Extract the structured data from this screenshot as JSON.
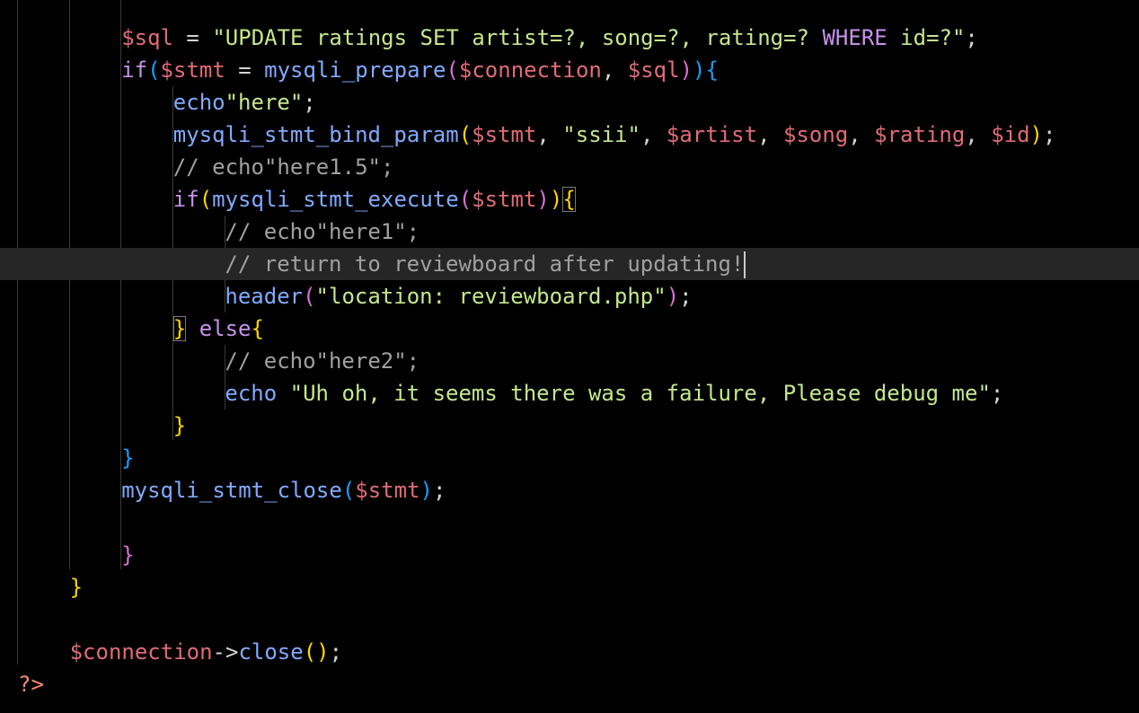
{
  "editor": {
    "language": "php",
    "theme_background": "#000000",
    "current_line_background": "#262626",
    "colors": {
      "variable": "#e06c75",
      "string": "#c3e88d",
      "keyword": "#c792ea",
      "function": "#82aaff",
      "comment": "#a0a0a0",
      "bracket_level_1": "#ffd700",
      "bracket_level_2": "#da70d6",
      "bracket_level_3": "#179fff",
      "php_tag": "#f78c6c"
    },
    "cursor_line": 8,
    "lines": [
      {
        "tokens": [
          {
            "c": "var",
            "t": "$sql"
          },
          {
            "c": "op",
            "t": " = "
          },
          {
            "c": "str",
            "t": "\"UPDATE ratings SET artist=?, song=?, rating=? "
          },
          {
            "c": "kw",
            "t": "WHERE"
          },
          {
            "c": "str",
            "t": " id=?\""
          },
          {
            "c": "op",
            "t": ";"
          }
        ]
      },
      {
        "tokens": [
          {
            "c": "kw",
            "t": "if"
          },
          {
            "c": "p3",
            "t": "("
          },
          {
            "c": "var",
            "t": "$stmt"
          },
          {
            "c": "op",
            "t": " = "
          },
          {
            "c": "fn",
            "t": "mysqli_prepare"
          },
          {
            "c": "p2",
            "t": "("
          },
          {
            "c": "var",
            "t": "$connection"
          },
          {
            "c": "op",
            "t": ", "
          },
          {
            "c": "var",
            "t": "$sql"
          },
          {
            "c": "p2",
            "t": ")"
          },
          {
            "c": "p3",
            "t": ")"
          },
          {
            "c": "p3",
            "t": "{"
          }
        ]
      },
      {
        "tokens": [
          {
            "c": "fn",
            "t": "echo"
          },
          {
            "c": "str",
            "t": "\"here\""
          },
          {
            "c": "op",
            "t": ";"
          }
        ]
      },
      {
        "tokens": [
          {
            "c": "fn",
            "t": "mysqli_stmt_bind_param"
          },
          {
            "c": "p1",
            "t": "("
          },
          {
            "c": "var",
            "t": "$stmt"
          },
          {
            "c": "op",
            "t": ", "
          },
          {
            "c": "str",
            "t": "\"ssii\""
          },
          {
            "c": "op",
            "t": ", "
          },
          {
            "c": "var",
            "t": "$artist"
          },
          {
            "c": "op",
            "t": ", "
          },
          {
            "c": "var",
            "t": "$song"
          },
          {
            "c": "op",
            "t": ", "
          },
          {
            "c": "var",
            "t": "$rating"
          },
          {
            "c": "op",
            "t": ", "
          },
          {
            "c": "var",
            "t": "$id"
          },
          {
            "c": "p1",
            "t": ")"
          },
          {
            "c": "op",
            "t": ";"
          }
        ]
      },
      {
        "tokens": [
          {
            "c": "cm",
            "t": "// echo\"here1.5\";"
          }
        ]
      },
      {
        "tokens": [
          {
            "c": "kw",
            "t": "if"
          },
          {
            "c": "p1",
            "t": "("
          },
          {
            "c": "fn",
            "t": "mysqli_stmt_execute"
          },
          {
            "c": "p2",
            "t": "("
          },
          {
            "c": "var",
            "t": "$stmt"
          },
          {
            "c": "p2",
            "t": ")"
          },
          {
            "c": "p1",
            "t": ")"
          },
          {
            "c": "p1 bm",
            "t": "{"
          }
        ]
      },
      {
        "tokens": [
          {
            "c": "cm",
            "t": "// echo\"here1\";"
          }
        ]
      },
      {
        "tokens": [
          {
            "c": "cm",
            "t": "// return to reviewboard after updating!"
          }
        ]
      },
      {
        "tokens": [
          {
            "c": "fn",
            "t": "header"
          },
          {
            "c": "p2",
            "t": "("
          },
          {
            "c": "str",
            "t": "\"location: reviewboard.php\""
          },
          {
            "c": "p2",
            "t": ")"
          },
          {
            "c": "op",
            "t": ";"
          }
        ]
      },
      {
        "tokens": [
          {
            "c": "p1 bm",
            "t": "}"
          },
          {
            "c": "op",
            "t": " "
          },
          {
            "c": "kw",
            "t": "else"
          },
          {
            "c": "p1",
            "t": "{"
          }
        ]
      },
      {
        "tokens": [
          {
            "c": "cm",
            "t": "// echo\"here2\";"
          }
        ]
      },
      {
        "tokens": [
          {
            "c": "fn",
            "t": "echo"
          },
          {
            "c": "op",
            "t": " "
          },
          {
            "c": "str",
            "t": "\"Uh oh, it seems there was a failure, Please debug me\""
          },
          {
            "c": "op",
            "t": ";"
          }
        ]
      },
      {
        "tokens": [
          {
            "c": "p1",
            "t": "}"
          }
        ]
      },
      {
        "tokens": [
          {
            "c": "p3",
            "t": "}"
          }
        ]
      },
      {
        "tokens": [
          {
            "c": "fn",
            "t": "mysqli_stmt_close"
          },
          {
            "c": "p3",
            "t": "("
          },
          {
            "c": "var",
            "t": "$stmt"
          },
          {
            "c": "p3",
            "t": ")"
          },
          {
            "c": "op",
            "t": ";"
          }
        ]
      },
      {
        "tokens": []
      },
      {
        "tokens": [
          {
            "c": "p2",
            "t": "}"
          }
        ]
      },
      {
        "tokens": [
          {
            "c": "p1",
            "t": "}"
          }
        ]
      },
      {
        "tokens": []
      },
      {
        "tokens": [
          {
            "c": "var",
            "t": "$connection"
          },
          {
            "c": "op",
            "t": "->"
          },
          {
            "c": "fn",
            "t": "close"
          },
          {
            "c": "p1",
            "t": "()"
          },
          {
            "c": "op",
            "t": ";"
          }
        ]
      },
      {
        "tokens": [
          {
            "c": "php",
            "t": "?>"
          }
        ]
      }
    ]
  }
}
